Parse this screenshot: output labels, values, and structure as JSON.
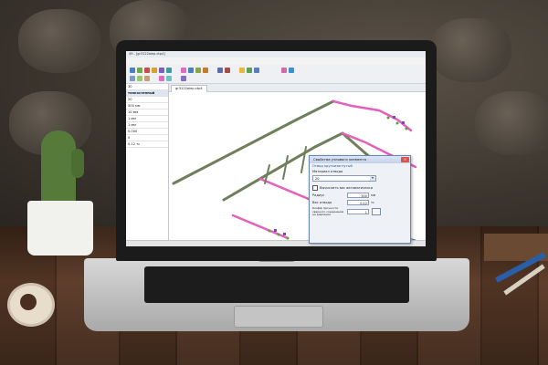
{
  "app": {
    "title": "49 - [gr3122aiep.ctp4]",
    "menu": [
      "Вид",
      "Навигация",
      "Вставка",
      "Инструменты",
      "Сервис",
      "Расчёт",
      "Результаты",
      "Окна",
      "Справка"
    ],
    "tab_label": "gr3122aiep.ctp4"
  },
  "left_panel": {
    "rows": [
      "30",
      "тонкостенный",
      "20",
      "500 мм",
      "10 мм",
      "1 мм",
      "1 мм",
      "0.000",
      "0",
      "0.12 тс"
    ]
  },
  "dialog": {
    "title": "Свойства узлового элемента",
    "section": "Отвод крутоизогнутый",
    "material_label": "Материал отвода",
    "material_value": "20",
    "auto_weight_label": "Вычислить вес автоматически",
    "radius_label": "Радиус",
    "radius_value": "500",
    "radius_unit": "мм",
    "weight_label": "Вес отвода",
    "weight_value": "0.12",
    "weight_unit": "тс",
    "coef_label": "Коэфф прочности сварного соединения на давление",
    "coef_value": "1"
  },
  "colors": {
    "pipe": "#6f7f5b",
    "pipe_highlight": "#e55fbd",
    "accent": "#1e4f9c"
  }
}
